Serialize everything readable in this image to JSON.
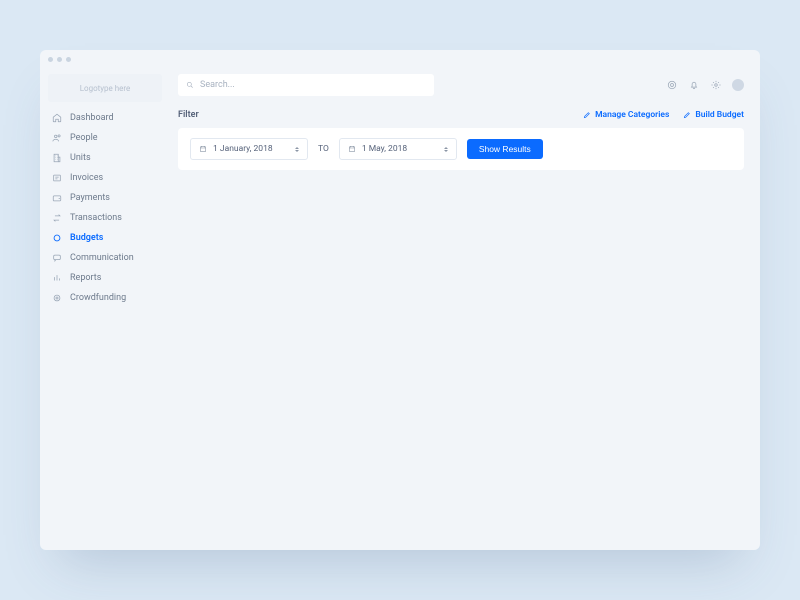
{
  "logo": "Logotype here",
  "sidebar": {
    "items": [
      {
        "label": "Dashboard"
      },
      {
        "label": "People"
      },
      {
        "label": "Units"
      },
      {
        "label": "Invoices"
      },
      {
        "label": "Payments"
      },
      {
        "label": "Transactions"
      },
      {
        "label": "Budgets",
        "active": true
      },
      {
        "label": "Communication"
      },
      {
        "label": "Reports"
      },
      {
        "label": "Crowdfunding"
      }
    ]
  },
  "search": {
    "placeholder": "Search..."
  },
  "filter": {
    "title": "Filter",
    "from": "1 January, 2018",
    "sep": "TO",
    "to": "1 May, 2018",
    "submit": "Show Results"
  },
  "actions": {
    "manage": "Manage Categories",
    "build": "Build Budget"
  }
}
